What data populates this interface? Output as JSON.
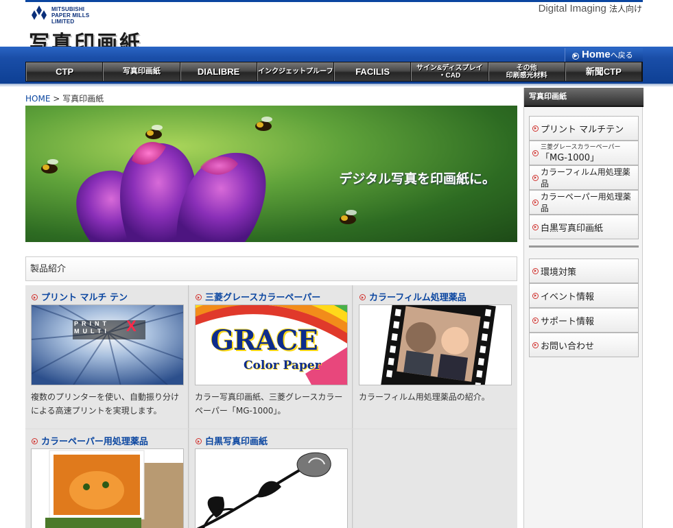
{
  "brand": {
    "company_line1": "MITSUBISHI",
    "company_line2": "PAPER MILLS",
    "company_line3": "LIMITED",
    "site_title": "写真印画紙",
    "tagline": "Digital Imaging",
    "tagline_sub": "法人向け"
  },
  "nav": {
    "home_label": "Home",
    "home_suffix": "へ戻る",
    "items": [
      {
        "label": "CTP"
      },
      {
        "label": "写真印画紙"
      },
      {
        "label": "DIALIBRE"
      },
      {
        "label": "インクジェットプルーフ"
      },
      {
        "label": "FACILIS"
      },
      {
        "label1": "サイン&ディスプレイ",
        "label2": "・CAD"
      },
      {
        "label1": "その他",
        "label2": "印刷感光材料"
      },
      {
        "label": "新聞CTP"
      }
    ]
  },
  "breadcrumb": {
    "home": "HOME",
    "sep": ">",
    "current": "写真印画紙"
  },
  "hero": {
    "text": "デジタル写真を印画紙に。"
  },
  "section": {
    "title": "製品紹介"
  },
  "products": [
    {
      "title": "プリント マルチ テン",
      "desc": "複数のプリンターを使い、自動振り分けによる高速プリントを実現します。",
      "img_text1": "PRINT",
      "img_text2": "MULTI",
      "img_text3": "X"
    },
    {
      "title": "三菱グレースカラーペーパー",
      "desc": "カラー写真印画紙、三菱グレースカラーペーパー「MG-1000」。",
      "img_text1": "GRACE",
      "img_text2": "Color Paper"
    },
    {
      "title": "カラーフィルム処理薬品",
      "desc": "カラーフィルム用処理薬品の紹介。"
    },
    {
      "title": "カラーペーパー用処理薬品",
      "desc": ""
    },
    {
      "title": "白黒写真印画紙",
      "desc": ""
    }
  ],
  "sidebar": {
    "header": "写真印画紙",
    "items": [
      {
        "label": "プリント マルチテン"
      },
      {
        "small": "三菱グレースカラーペーパー",
        "label": "「MG-1000」"
      },
      {
        "label": "カラーフィルム用処理薬品"
      },
      {
        "label": "カラーペーパー用処理薬品"
      },
      {
        "label": "白黒写真印画紙"
      }
    ],
    "items2": [
      {
        "label": "環境対策"
      },
      {
        "label": "イベント情報"
      },
      {
        "label": "サポート情報"
      },
      {
        "label": "お問い合わせ"
      }
    ]
  },
  "colors": {
    "brand_blue": "#0b46a0",
    "bullet_red": "#d0312d",
    "nav_dark": "#262626"
  }
}
